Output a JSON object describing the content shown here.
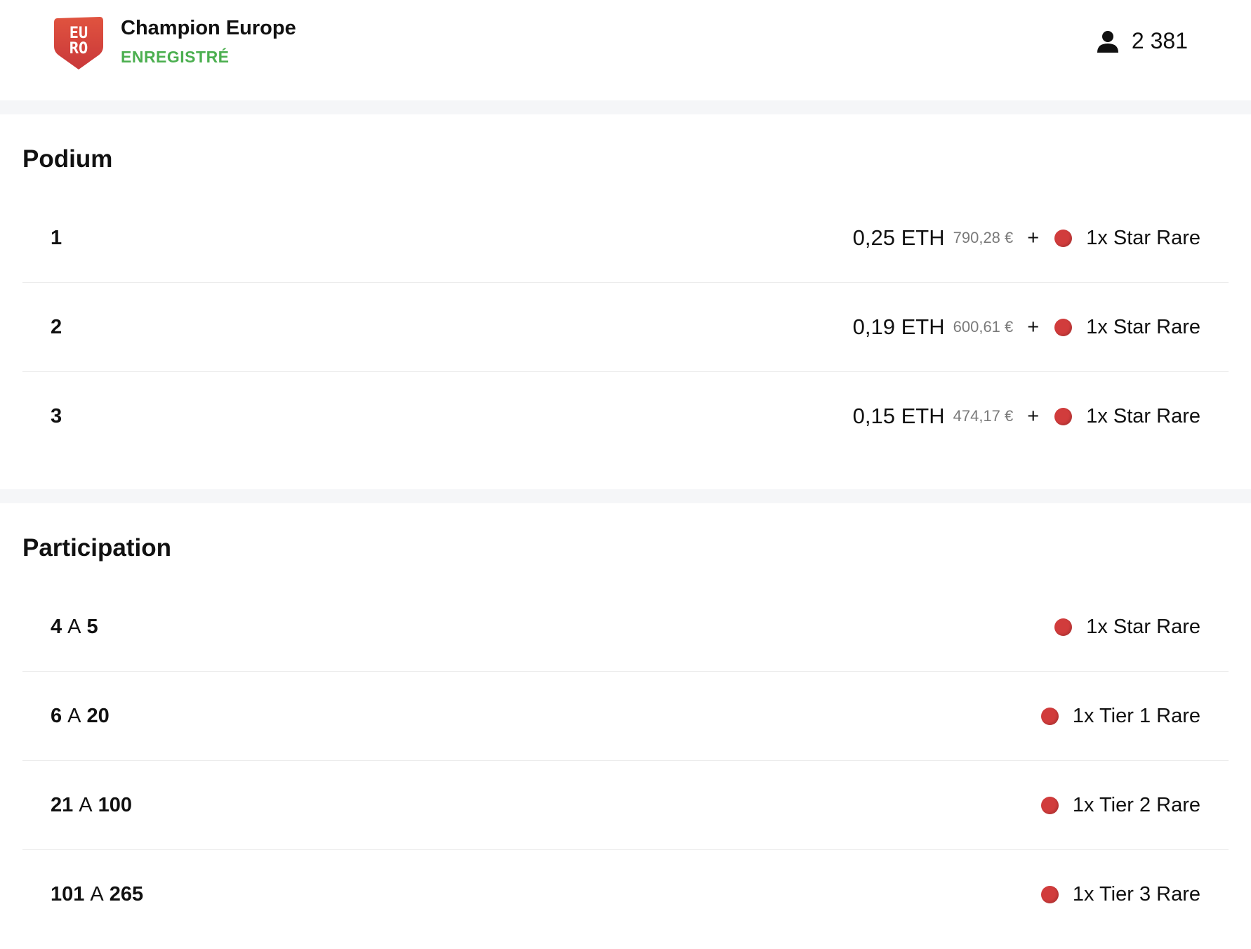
{
  "header": {
    "logo_text_line1": "EU",
    "logo_text_line2": "RO",
    "title": "Champion Europe",
    "status": "ENREGISTRÉ",
    "participants": "2 381",
    "colors": {
      "status": "#4caf50",
      "logo": "#d84a3c",
      "card_dot": "#d13c3c"
    }
  },
  "podium": {
    "title": "Podium",
    "rows": [
      {
        "rank": "1",
        "eth": "0,25 ETH",
        "fiat": "790,28 €",
        "plus": "+",
        "card": "1x Star Rare"
      },
      {
        "rank": "2",
        "eth": "0,19 ETH",
        "fiat": "600,61 €",
        "plus": "+",
        "card": "1x Star Rare"
      },
      {
        "rank": "3",
        "eth": "0,15 ETH",
        "fiat": "474,17 €",
        "plus": "+",
        "card": "1x Star Rare"
      }
    ]
  },
  "participation": {
    "title": "Participation",
    "rows": [
      {
        "from": "4",
        "sep": "A",
        "to": "5",
        "card": "1x Star Rare"
      },
      {
        "from": "6",
        "sep": "A",
        "to": "20",
        "card": "1x Tier 1 Rare"
      },
      {
        "from": "21",
        "sep": "A",
        "to": "100",
        "card": "1x Tier 2 Rare"
      },
      {
        "from": "101",
        "sep": "A",
        "to": "265",
        "card": "1x Tier 3 Rare"
      }
    ]
  }
}
